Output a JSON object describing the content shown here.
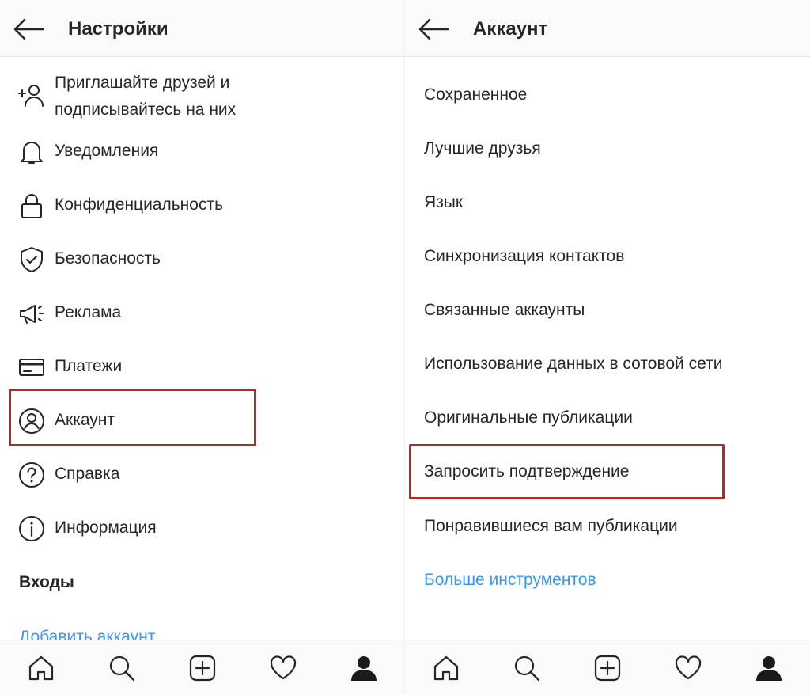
{
  "left": {
    "header": {
      "title": "Настройки"
    },
    "items": [
      {
        "label_line1": "Приглашайте друзей и",
        "label_line2": "подписывайтесь на них",
        "icon": "add-person-icon"
      },
      {
        "label": "Уведомления",
        "icon": "bell-icon"
      },
      {
        "label": "Конфиденциальность",
        "icon": "lock-icon"
      },
      {
        "label": "Безопасность",
        "icon": "shield-check-icon"
      },
      {
        "label": "Реклама",
        "icon": "megaphone-icon"
      },
      {
        "label": "Платежи",
        "icon": "card-icon"
      },
      {
        "label": "Аккаунт",
        "icon": "account-circle-icon",
        "highlighted": true
      },
      {
        "label": "Справка",
        "icon": "help-circle-icon"
      },
      {
        "label": "Информация",
        "icon": "info-circle-icon"
      }
    ],
    "section": {
      "label": "Входы"
    },
    "add_account": {
      "label": "Добавить аккаунт"
    }
  },
  "right": {
    "header": {
      "title": "Аккаунт"
    },
    "items": [
      {
        "label": "Сохраненное"
      },
      {
        "label": "Лучшие друзья"
      },
      {
        "label": "Язык"
      },
      {
        "label": "Синхронизация контактов"
      },
      {
        "label": "Связанные аккаунты"
      },
      {
        "label": "Использование данных в сотовой сети"
      },
      {
        "label": "Оригинальные публикации"
      },
      {
        "label": "Запросить подтверждение",
        "highlighted": true
      },
      {
        "label": "Понравившиеся вам публикации"
      }
    ],
    "more_tools": {
      "label": "Больше инструментов"
    }
  },
  "bottom_nav": [
    "home-icon",
    "search-icon",
    "new-post-icon",
    "heart-icon",
    "profile-icon"
  ],
  "colors": {
    "highlight": "#b3272b",
    "link": "#3897f0",
    "text": "#262626"
  }
}
